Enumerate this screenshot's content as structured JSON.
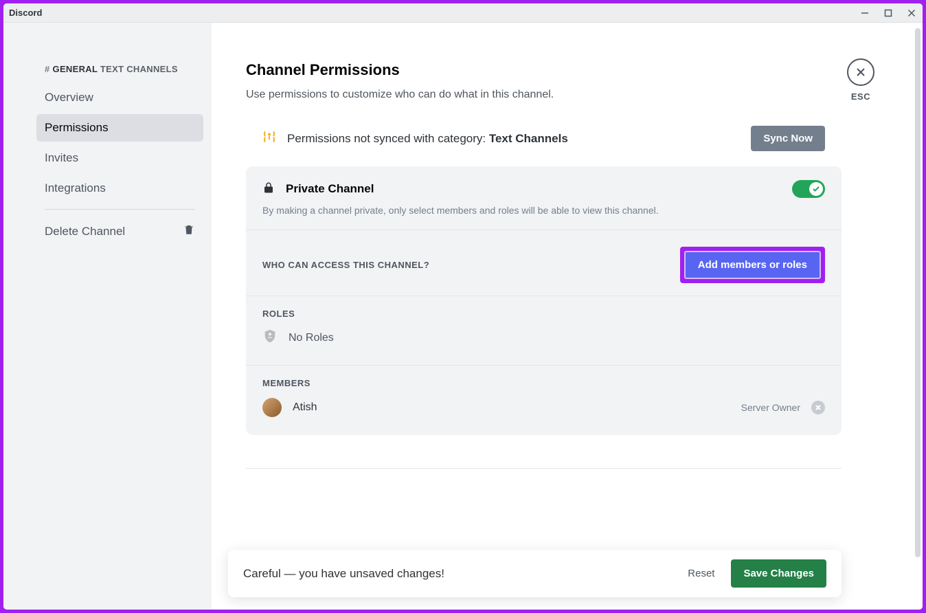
{
  "window": {
    "title": "Discord",
    "esc_label": "ESC"
  },
  "sidebar": {
    "channel_prefix": "#",
    "channel_name": "GENERAL",
    "category_label": "TEXT CHANNELS",
    "items": [
      {
        "label": "Overview"
      },
      {
        "label": "Permissions"
      },
      {
        "label": "Invites"
      },
      {
        "label": "Integrations"
      }
    ],
    "delete_label": "Delete Channel"
  },
  "page": {
    "title": "Channel Permissions",
    "description": "Use permissions to customize who can do what in this channel."
  },
  "sync": {
    "text_prefix": "Permissions not synced with category: ",
    "category": "Text Channels",
    "button": "Sync Now"
  },
  "private": {
    "title": "Private Channel",
    "description": "By making a channel private, only select members and roles will be able to view this channel.",
    "enabled": true
  },
  "access": {
    "heading": "WHO CAN ACCESS THIS CHANNEL?",
    "add_button": "Add members or roles"
  },
  "roles": {
    "heading": "ROLES",
    "empty_text": "No Roles"
  },
  "members": {
    "heading": "MEMBERS",
    "list": [
      {
        "name": "Atish",
        "badge": "Server Owner"
      }
    ]
  },
  "unsaved": {
    "text": "Careful — you have unsaved changes!",
    "reset": "Reset",
    "save": "Save Changes"
  }
}
